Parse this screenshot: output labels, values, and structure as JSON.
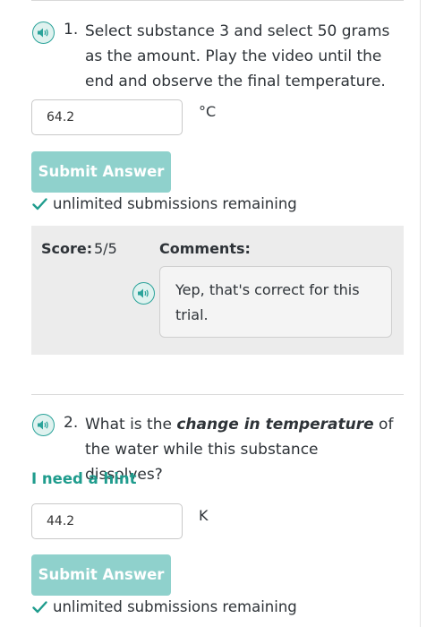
{
  "question1": {
    "number": "1.",
    "text": "Select substance 3 and select 50 grams as the amount. Play the video until the end and observe the final temperature.",
    "answer_value": "64.2",
    "unit": "°C",
    "submit_label": "Submit Answer",
    "status": "unlimited submissions remaining",
    "feedback": {
      "score_label": "Score:",
      "score_value": "5/5",
      "comments_label": "Comments:",
      "comment_text": "Yep, that's correct for this trial."
    }
  },
  "question2": {
    "number": "2.",
    "text_before": "What is the ",
    "text_emphasis": "change in temperature",
    "text_after": " of the water while this substance dissolves?",
    "hint_label": "I need a hint",
    "answer_value": "44.2",
    "unit": "K",
    "submit_label": "Submit Answer",
    "status": "unlimited submissions remaining"
  },
  "icons": {
    "audio": "speaker-audio-icon",
    "check": "checkmark-icon"
  },
  "colors": {
    "accent": "#2ba39a",
    "button": "#8fd1cc",
    "link": "#1f9c8d",
    "feedback_bg": "#ececec"
  }
}
